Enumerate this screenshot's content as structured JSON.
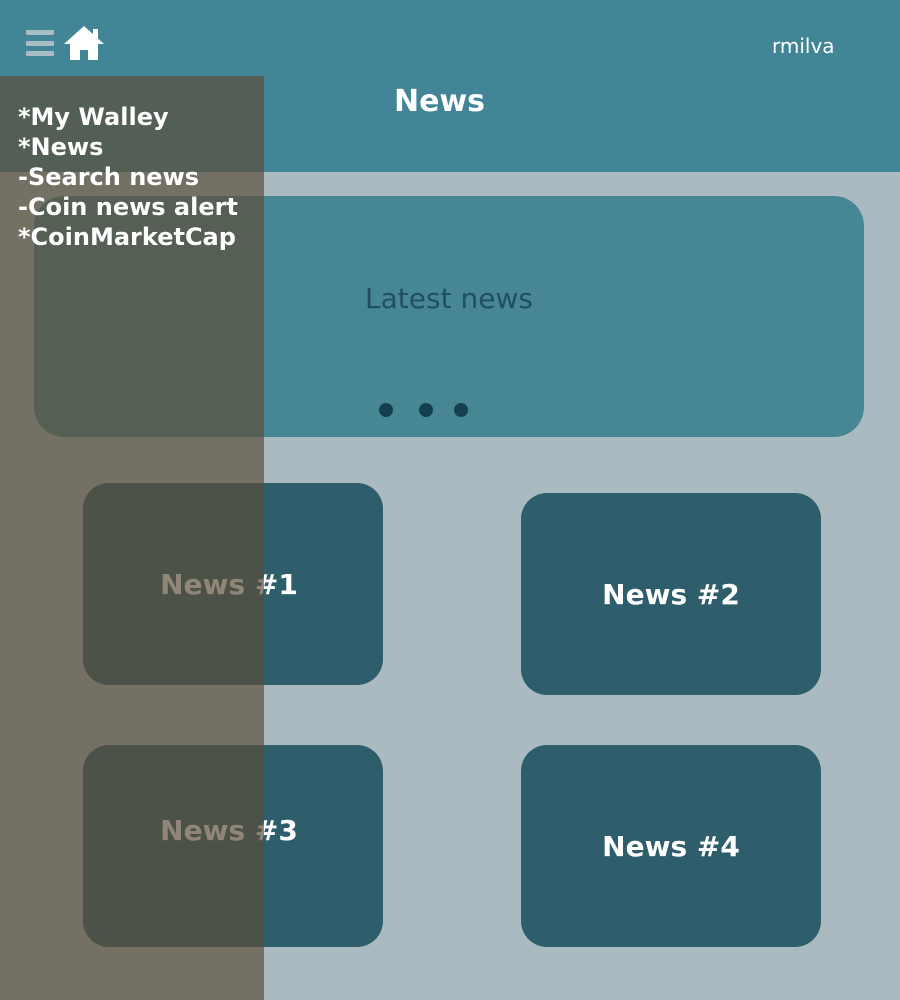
{
  "header": {
    "username": "rmilva",
    "title": "News",
    "menu_icon": "hamburger-menu-icon",
    "home_icon": "home-icon"
  },
  "banner": {
    "title": "Latest news",
    "dots": 3
  },
  "news_cards": [
    {
      "label": "News #1"
    },
    {
      "label": "News #2"
    },
    {
      "label": "News #3"
    },
    {
      "label": "News #4"
    }
  ],
  "side_menu": {
    "items": [
      {
        "label": "*My Walley"
      },
      {
        "label": "*News"
      },
      {
        "label": "-Search news"
      },
      {
        "label": "-Coin news alert"
      },
      {
        "label": "*CoinMarketCap"
      }
    ]
  },
  "colors": {
    "header_bg": "#418597",
    "page_bg": "#a9bbc1",
    "banner_bg": "#478793",
    "card_bg": "#2e5e6b",
    "menu_overlay": "#5c4c36"
  }
}
